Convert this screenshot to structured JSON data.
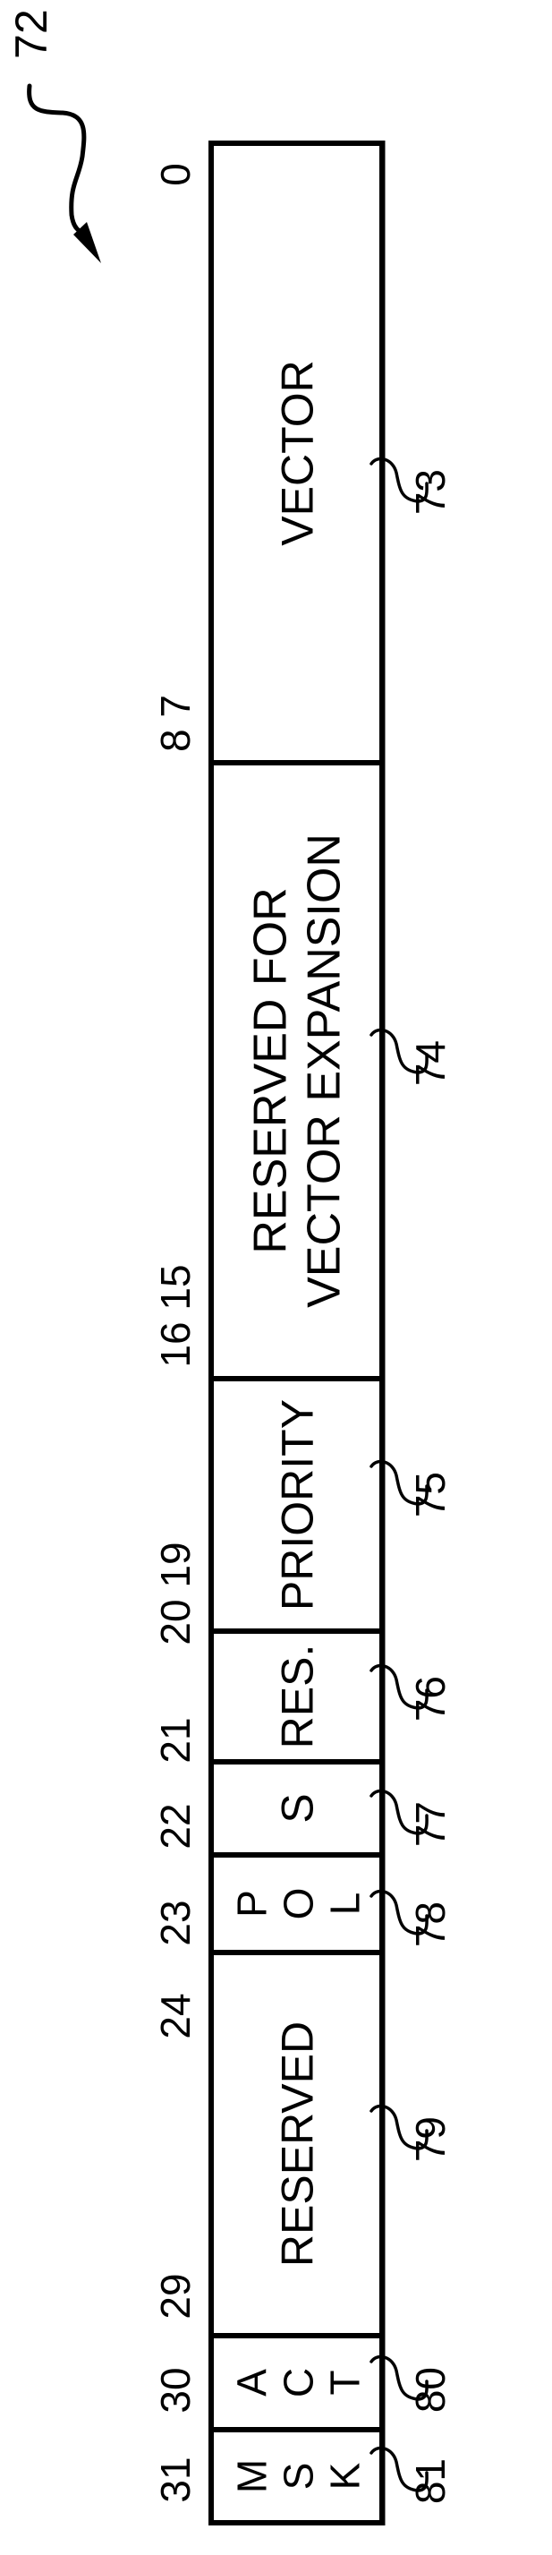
{
  "figure": {
    "reference_numeral": "72",
    "colors": {
      "ink": "#000000",
      "paper": "#ffffff"
    }
  },
  "register": {
    "bit_start": 0,
    "bit_end": 31,
    "fields": [
      {
        "bits": [
          0,
          7
        ],
        "lines": [
          "VECTOR"
        ],
        "ref": "73",
        "orientation": "rotated"
      },
      {
        "bits": [
          8,
          15
        ],
        "lines": [
          "RESERVED FOR",
          "VECTOR EXPANSION"
        ],
        "ref": "74",
        "orientation": "rotated"
      },
      {
        "bits": [
          16,
          19
        ],
        "lines": [
          "PRIORITY"
        ],
        "ref": "75",
        "orientation": "rotated"
      },
      {
        "bits": [
          20,
          21
        ],
        "lines": [
          "RES."
        ],
        "ref": "76",
        "orientation": "rotated"
      },
      {
        "bits": [
          22,
          22
        ],
        "lines": [
          "S"
        ],
        "ref": "77",
        "orientation": "rotated"
      },
      {
        "bits": [
          23,
          23
        ],
        "lines": [
          "P",
          "O",
          "L"
        ],
        "ref": "78",
        "orientation": "stacked"
      },
      {
        "bits": [
          24,
          29
        ],
        "lines": [
          "RESERVED"
        ],
        "ref": "79",
        "orientation": "rotated"
      },
      {
        "bits": [
          30,
          30
        ],
        "lines": [
          "A",
          "C",
          "T"
        ],
        "ref": "80",
        "orientation": "stacked"
      },
      {
        "bits": [
          31,
          31
        ],
        "lines": [
          "M",
          "S",
          "K"
        ],
        "ref": "81",
        "orientation": "stacked"
      }
    ],
    "bit_labels": [
      {
        "text": "0"
      },
      {
        "text": "8 7"
      },
      {
        "text": "16 15"
      },
      {
        "text": "20 19"
      },
      {
        "text": "21"
      },
      {
        "text": "22"
      },
      {
        "text": "23"
      },
      {
        "text": "24"
      },
      {
        "text": "29"
      },
      {
        "text": "30"
      },
      {
        "text": "31"
      }
    ]
  }
}
